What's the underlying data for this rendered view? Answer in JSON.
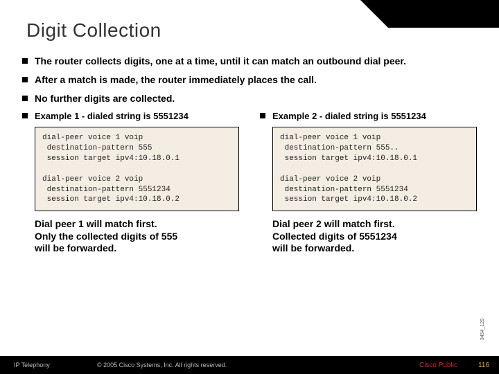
{
  "title": "Digit Collection",
  "bullets": [
    "The router collects digits, one at a time, until it can match an outbound dial peer.",
    "After a match is made, the router immediately places the call.",
    "No further digits are collected."
  ],
  "examples": [
    {
      "heading": "Example 1 - dialed string is 5551234",
      "code": "dial-peer voice 1 voip\n destination-pattern 555\n session target ipv4:10.18.0.1\n\ndial-peer voice 2 voip\n destination-pattern 5551234\n session target ipv4:10.18.0.2",
      "note": "Dial peer 1 will match first.\nOnly the collected digits of 555\nwill be forwarded."
    },
    {
      "heading": "Example 2 - dialed string is 5551234",
      "code": "dial-peer voice 1 voip\n destination-pattern 555..\n session target ipv4:10.18.0.1\n\ndial-peer voice 2 voip\n destination-pattern 5551234\n session target ipv4:10.18.0.2",
      "note": "Dial peer 2 will match first.\nCollected digits of 5551234\nwill be forwarded."
    }
  ],
  "sidelabel": "3454_129",
  "footer": {
    "left": "IP Telephony",
    "center": "© 2005 Cisco Systems, Inc. All rights reserved.",
    "public": "Cisco Public",
    "pagenum": "116"
  }
}
